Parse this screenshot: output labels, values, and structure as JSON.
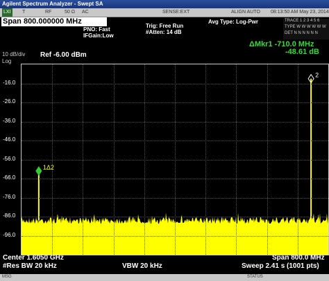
{
  "window": {
    "title": "Agilent Spectrum Analyzer - Swept SA"
  },
  "menubar": {
    "lxi": "LXI",
    "t": "T",
    "rf": "RF",
    "ohm": "50 Ω",
    "ac": "AC",
    "sense": "SENSE:EXT",
    "align": "ALIGN AUTO",
    "datetime": "08:13:50 AM May 23, 2014"
  },
  "header": {
    "span": "Span 800.000000 MHz",
    "pno": "PNO: Fast",
    "ifgain": "IFGain:Low",
    "trig": "Trig: Free Run",
    "atten": "#Atten: 14 dB",
    "avg_type": "Avg Type: Log-Pwr",
    "trace_row1": "TRACE 1 2 3 4 5 6",
    "trace_row2": "TYPE W W W W W W",
    "trace_row3": "DET N N N N N N",
    "marker_title": "ΔMkr1 -710.0 MHz",
    "marker_value": "-48.61 dB"
  },
  "plot": {
    "scale": "10 dB/div",
    "scale_type": "Log",
    "ref_level": "Ref -6.00 dBm",
    "y_ticks": [
      "-16.0",
      "-26.0",
      "-36.0",
      "-46.0",
      "-56.0",
      "-66.0",
      "-76.0",
      "-86.0",
      "-96.0"
    ],
    "markers": [
      {
        "label": "1Δ2",
        "freq_mhz": 1250.0,
        "level_dbm": -62.0
      },
      {
        "label": "2",
        "freq_mhz": 1960.0,
        "level_dbm": -13.5
      }
    ],
    "noise_floor_dbm": -88,
    "colors": {
      "trace": "#ffff00",
      "marker": "#33cc33",
      "grid": "#555555"
    }
  },
  "footer": {
    "center": "Center 1.6050 GHz",
    "res_bw": "#Res BW 20 kHz",
    "vbw": "VBW 20 kHz",
    "span": "Span 800.0 MHz",
    "sweep": "Sweep  2.41 s (1001 pts)"
  },
  "statusbar": {
    "msg": "MSG",
    "status": "STATUS"
  }
}
